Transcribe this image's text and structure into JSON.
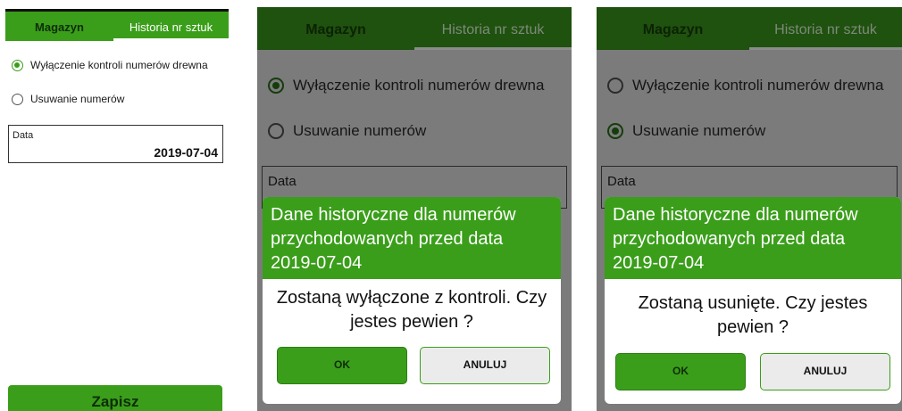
{
  "screen1": {
    "tabs": [
      "Magazyn",
      "Historia nr sztuk"
    ],
    "radio_options": [
      "Wyłączenie kontroli numerów drewna",
      "Usuwanie numerów"
    ],
    "selected_option_index": 0,
    "date_label": "Data",
    "date_value": "2019-07-04",
    "save_label": "Zapisz"
  },
  "screen2": {
    "tabs": [
      "Magazyn",
      "Historia nr sztuk"
    ],
    "radio_options": [
      "Wyłączenie kontroli numerów drewna",
      "Usuwanie numerów"
    ],
    "selected_option_index": 0,
    "date_label": "Data",
    "dialog": {
      "title": "Dane historyczne dla numerów przychodowanych przed data 2019-07-04",
      "message": "Zostaną wyłączone z kontroli. Czy jestes pewien ?",
      "ok_label": "OK",
      "cancel_label": "ANULUJ"
    }
  },
  "screen3": {
    "tabs": [
      "Magazyn",
      "Historia nr sztuk"
    ],
    "radio_options": [
      "Wyłączenie kontroli numerów drewna",
      "Usuwanie numerów"
    ],
    "selected_option_index": 1,
    "date_label": "Data",
    "dialog": {
      "title": "Dane historyczne dla numerów przychodowanych przed data 2019-07-04",
      "message": "Zostaną usunięte. Czy jestes pewien ?",
      "ok_label": "OK",
      "cancel_label": "ANULUJ"
    }
  },
  "colors": {
    "accent_green": "#3a9e1a",
    "dimmed_overlay": "#7b7b7b",
    "white": "#ffffff"
  }
}
